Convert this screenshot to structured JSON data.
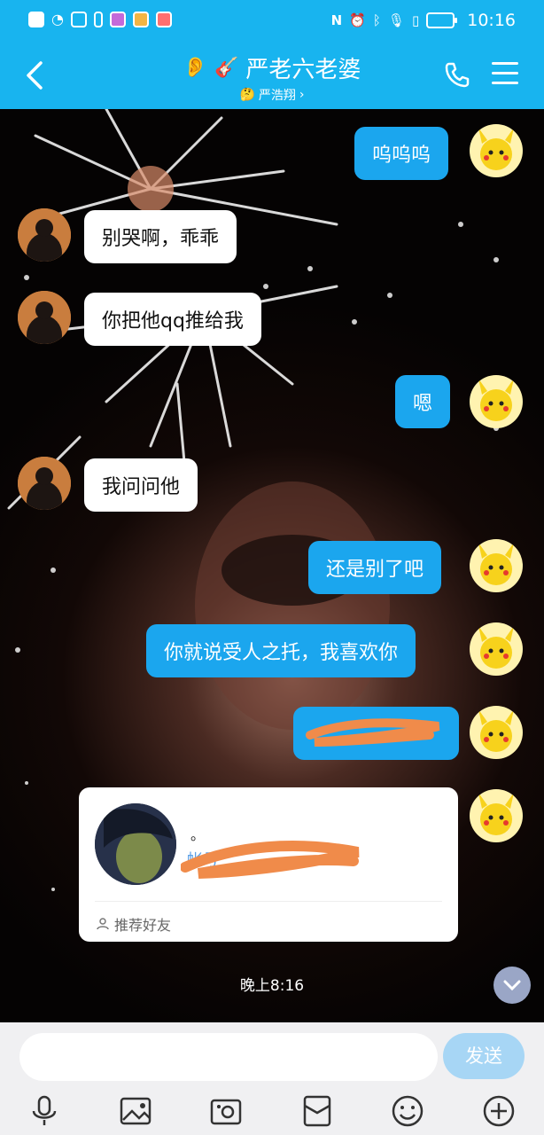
{
  "status_bar": {
    "time": "10:16"
  },
  "header": {
    "title": "严老六老婆",
    "title_emoji": "🎸",
    "subtitle": "严浩翔",
    "subtitle_emoji": "🤔",
    "subtitle_arrow": "›"
  },
  "messages": [
    {
      "side": "me",
      "text": "呜呜呜"
    },
    {
      "side": "them",
      "text": "别哭啊，乖乖"
    },
    {
      "side": "them",
      "text": "你把他qq推给我"
    },
    {
      "side": "me",
      "text": "嗯"
    },
    {
      "side": "them",
      "text": "我问问他"
    },
    {
      "side": "me",
      "text": "还是别了吧"
    },
    {
      "side": "me",
      "text": "你就说受人之托，我喜欢你"
    },
    {
      "side": "me",
      "text": ""
    }
  ],
  "contact_card": {
    "name": "。",
    "account_prefix": "帐号",
    "footer": "推荐好友"
  },
  "timestamp": "晚上8:16",
  "input": {
    "placeholder": "",
    "send_label": "发送"
  },
  "colors": {
    "header_bg": "#18b4ef",
    "bubble_me": "#1ba6ee",
    "send_disabled": "#a7d6f5"
  },
  "toolbar_icons": [
    "microphone-icon",
    "image-icon",
    "camera-icon",
    "red-envelope-icon",
    "emoji-icon",
    "plus-icon"
  ]
}
